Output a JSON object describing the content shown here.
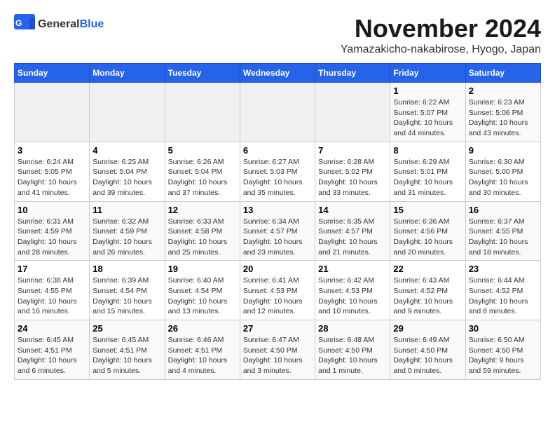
{
  "logo": {
    "general": "General",
    "blue": "Blue"
  },
  "title": "November 2024",
  "location": "Yamazakicho-nakabirose, Hyogo, Japan",
  "days_header": [
    "Sunday",
    "Monday",
    "Tuesday",
    "Wednesday",
    "Thursday",
    "Friday",
    "Saturday"
  ],
  "weeks": [
    [
      {
        "day": "",
        "info": ""
      },
      {
        "day": "",
        "info": ""
      },
      {
        "day": "",
        "info": ""
      },
      {
        "day": "",
        "info": ""
      },
      {
        "day": "",
        "info": ""
      },
      {
        "day": "1",
        "info": "Sunrise: 6:22 AM\nSunset: 5:07 PM\nDaylight: 10 hours\nand 44 minutes."
      },
      {
        "day": "2",
        "info": "Sunrise: 6:23 AM\nSunset: 5:06 PM\nDaylight: 10 hours\nand 43 minutes."
      }
    ],
    [
      {
        "day": "3",
        "info": "Sunrise: 6:24 AM\nSunset: 5:05 PM\nDaylight: 10 hours\nand 41 minutes."
      },
      {
        "day": "4",
        "info": "Sunrise: 6:25 AM\nSunset: 5:04 PM\nDaylight: 10 hours\nand 39 minutes."
      },
      {
        "day": "5",
        "info": "Sunrise: 6:26 AM\nSunset: 5:04 PM\nDaylight: 10 hours\nand 37 minutes."
      },
      {
        "day": "6",
        "info": "Sunrise: 6:27 AM\nSunset: 5:03 PM\nDaylight: 10 hours\nand 35 minutes."
      },
      {
        "day": "7",
        "info": "Sunrise: 6:28 AM\nSunset: 5:02 PM\nDaylight: 10 hours\nand 33 minutes."
      },
      {
        "day": "8",
        "info": "Sunrise: 6:29 AM\nSunset: 5:01 PM\nDaylight: 10 hours\nand 31 minutes."
      },
      {
        "day": "9",
        "info": "Sunrise: 6:30 AM\nSunset: 5:00 PM\nDaylight: 10 hours\nand 30 minutes."
      }
    ],
    [
      {
        "day": "10",
        "info": "Sunrise: 6:31 AM\nSunset: 4:59 PM\nDaylight: 10 hours\nand 28 minutes."
      },
      {
        "day": "11",
        "info": "Sunrise: 6:32 AM\nSunset: 4:59 PM\nDaylight: 10 hours\nand 26 minutes."
      },
      {
        "day": "12",
        "info": "Sunrise: 6:33 AM\nSunset: 4:58 PM\nDaylight: 10 hours\nand 25 minutes."
      },
      {
        "day": "13",
        "info": "Sunrise: 6:34 AM\nSunset: 4:57 PM\nDaylight: 10 hours\nand 23 minutes."
      },
      {
        "day": "14",
        "info": "Sunrise: 6:35 AM\nSunset: 4:57 PM\nDaylight: 10 hours\nand 21 minutes."
      },
      {
        "day": "15",
        "info": "Sunrise: 6:36 AM\nSunset: 4:56 PM\nDaylight: 10 hours\nand 20 minutes."
      },
      {
        "day": "16",
        "info": "Sunrise: 6:37 AM\nSunset: 4:55 PM\nDaylight: 10 hours\nand 18 minutes."
      }
    ],
    [
      {
        "day": "17",
        "info": "Sunrise: 6:38 AM\nSunset: 4:55 PM\nDaylight: 10 hours\nand 16 minutes."
      },
      {
        "day": "18",
        "info": "Sunrise: 6:39 AM\nSunset: 4:54 PM\nDaylight: 10 hours\nand 15 minutes."
      },
      {
        "day": "19",
        "info": "Sunrise: 6:40 AM\nSunset: 4:54 PM\nDaylight: 10 hours\nand 13 minutes."
      },
      {
        "day": "20",
        "info": "Sunrise: 6:41 AM\nSunset: 4:53 PM\nDaylight: 10 hours\nand 12 minutes."
      },
      {
        "day": "21",
        "info": "Sunrise: 6:42 AM\nSunset: 4:53 PM\nDaylight: 10 hours\nand 10 minutes."
      },
      {
        "day": "22",
        "info": "Sunrise: 6:43 AM\nSunset: 4:52 PM\nDaylight: 10 hours\nand 9 minutes."
      },
      {
        "day": "23",
        "info": "Sunrise: 6:44 AM\nSunset: 4:52 PM\nDaylight: 10 hours\nand 8 minutes."
      }
    ],
    [
      {
        "day": "24",
        "info": "Sunrise: 6:45 AM\nSunset: 4:51 PM\nDaylight: 10 hours\nand 6 minutes."
      },
      {
        "day": "25",
        "info": "Sunrise: 6:45 AM\nSunset: 4:51 PM\nDaylight: 10 hours\nand 5 minutes."
      },
      {
        "day": "26",
        "info": "Sunrise: 6:46 AM\nSunset: 4:51 PM\nDaylight: 10 hours\nand 4 minutes."
      },
      {
        "day": "27",
        "info": "Sunrise: 6:47 AM\nSunset: 4:50 PM\nDaylight: 10 hours\nand 3 minutes."
      },
      {
        "day": "28",
        "info": "Sunrise: 6:48 AM\nSunset: 4:50 PM\nDaylight: 10 hours\nand 1 minute."
      },
      {
        "day": "29",
        "info": "Sunrise: 6:49 AM\nSunset: 4:50 PM\nDaylight: 10 hours\nand 0 minutes."
      },
      {
        "day": "30",
        "info": "Sunrise: 6:50 AM\nSunset: 4:50 PM\nDaylight: 9 hours\nand 59 minutes."
      }
    ]
  ]
}
